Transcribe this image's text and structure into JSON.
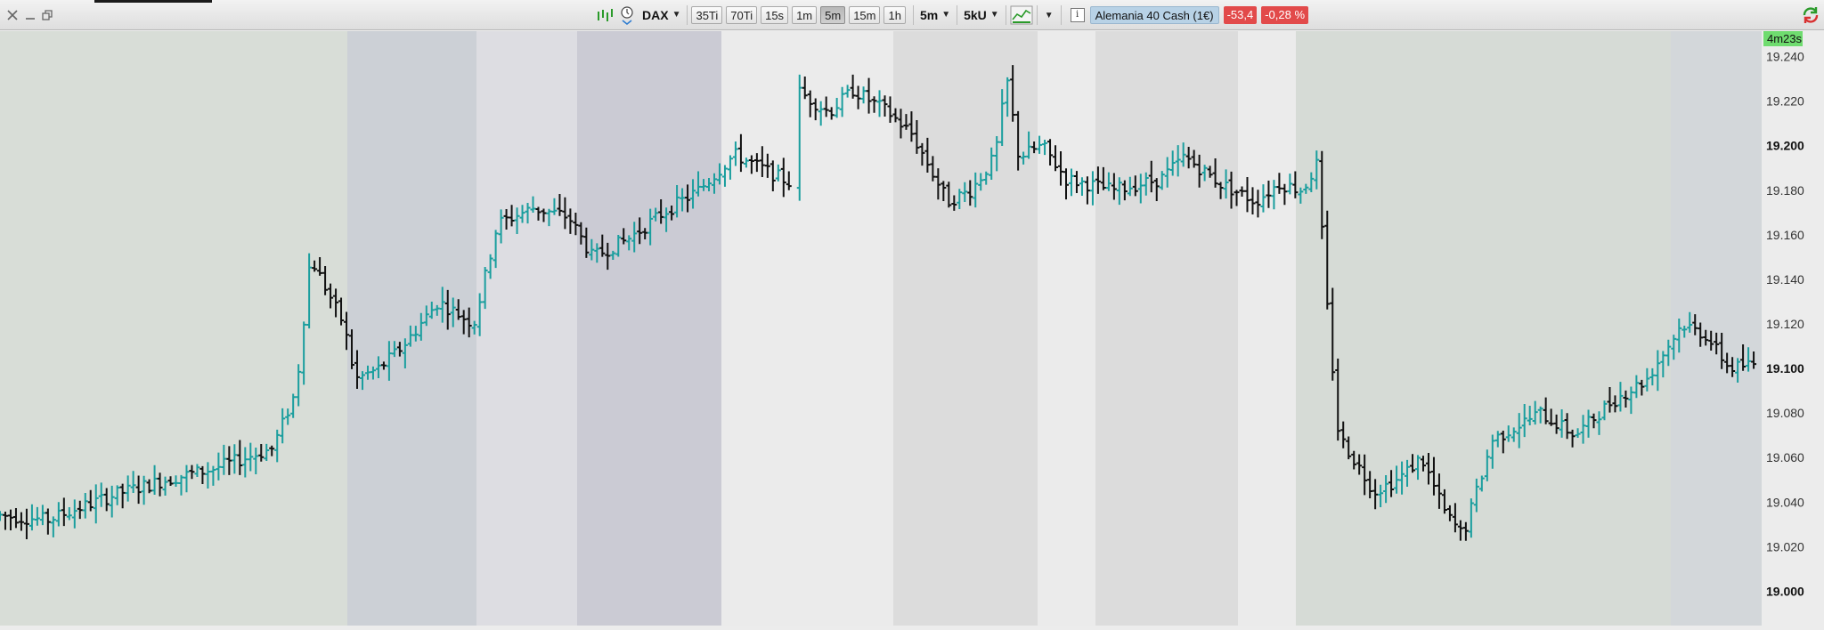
{
  "window": {
    "controls": [
      "close-icon",
      "minimize-icon",
      "restore-icon"
    ]
  },
  "toolbar": {
    "instrument": "DAX",
    "tick_buttons": [
      "35Ti",
      "70Ti",
      "15s",
      "1m",
      "5m",
      "15m",
      "1h"
    ],
    "active_interval": "5m",
    "interval_select": "5m",
    "units_select": "5kU",
    "instrument_name": "Alemania 40 Cash (1€)",
    "change_points": "-53,4",
    "change_percent": "-0,28 %",
    "colors": {
      "down": "#e24a4a",
      "instrument_bg": "#b8d2e6"
    }
  },
  "chart": {
    "timer": "4m23s",
    "price_axis": {
      "labels": [
        "19.240",
        "19.220",
        "19.200",
        "19.180",
        "19.160",
        "19.140",
        "19.120",
        "19.100",
        "19.080",
        "19.060",
        "19.040",
        "19.020",
        "19.000"
      ],
      "bold_labels": [
        "19.200",
        "19.100",
        "19.000"
      ]
    },
    "colors": {
      "up": "#1a9e9e",
      "down": "#111111",
      "timer_bg": "#6fdc6f"
    }
  },
  "chart_data": {
    "type": "ohlc",
    "instrument": "DAX",
    "interval": "5m",
    "ylim": [
      18995,
      19245
    ],
    "yticks": [
      19000,
      19020,
      19040,
      19060,
      19080,
      19100,
      19120,
      19140,
      19160,
      19180,
      19200,
      19220,
      19240
    ],
    "path_anchors": [
      [
        0,
        19034
      ],
      [
        40,
        19032
      ],
      [
        100,
        19044
      ],
      [
        140,
        19050
      ],
      [
        180,
        19055
      ],
      [
        230,
        19064
      ],
      [
        250,
        19090
      ],
      [
        262,
        19150
      ],
      [
        290,
        19120
      ],
      [
        300,
        19095
      ],
      [
        320,
        19100
      ],
      [
        340,
        19110
      ],
      [
        370,
        19130
      ],
      [
        400,
        19120
      ],
      [
        420,
        19165
      ],
      [
        450,
        19172
      ],
      [
        480,
        19168
      ],
      [
        500,
        19150
      ],
      [
        530,
        19158
      ],
      [
        560,
        19170
      ],
      [
        590,
        19180
      ],
      [
        620,
        19196
      ],
      [
        650,
        19188
      ],
      [
        668,
        19183
      ],
      [
        672,
        19225
      ],
      [
        700,
        19215
      ],
      [
        720,
        19225
      ],
      [
        750,
        19215
      ],
      [
        770,
        19205
      ],
      [
        800,
        19175
      ],
      [
        820,
        19180
      ],
      [
        840,
        19195
      ],
      [
        850,
        19230
      ],
      [
        860,
        19195
      ],
      [
        880,
        19200
      ],
      [
        900,
        19185
      ],
      [
        940,
        19180
      ],
      [
        980,
        19185
      ],
      [
        1000,
        19195
      ],
      [
        1030,
        19183
      ],
      [
        1060,
        19175
      ],
      [
        1080,
        19183
      ],
      [
        1100,
        19180
      ],
      [
        1112,
        19192
      ],
      [
        1120,
        19130
      ],
      [
        1130,
        19070
      ],
      [
        1160,
        19045
      ],
      [
        1180,
        19050
      ],
      [
        1200,
        19060
      ],
      [
        1220,
        19035
      ],
      [
        1235,
        19025
      ],
      [
        1260,
        19068
      ],
      [
        1300,
        19080
      ],
      [
        1330,
        19070
      ],
      [
        1360,
        19085
      ],
      [
        1390,
        19095
      ],
      [
        1420,
        19120
      ],
      [
        1440,
        19115
      ],
      [
        1460,
        19100
      ],
      [
        1480,
        19102
      ],
      [
        1490,
        19098
      ],
      [
        1512,
        19100
      ]
    ],
    "bar_spacing_px": 4.5
  }
}
